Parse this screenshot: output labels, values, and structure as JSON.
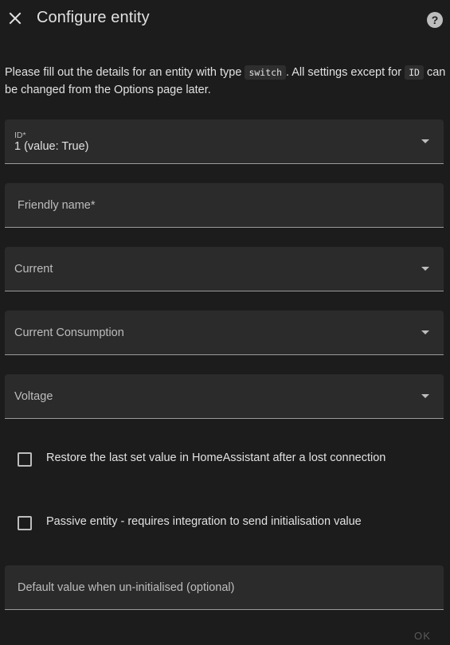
{
  "header": {
    "title": "Configure entity",
    "close_icon": "close-icon",
    "help_icon": "help-circle-icon"
  },
  "description": {
    "part1": "Please fill out the details for an entity with type ",
    "type_code": "switch",
    "part2": ". All settings except for ",
    "id_code": "ID",
    "part3": " can be changed from the Options page later."
  },
  "fields": {
    "id": {
      "label": "ID*",
      "value": "1 (value: True)"
    },
    "friendly_name": {
      "label": "Friendly name*",
      "value": ""
    },
    "current": {
      "label": "Current",
      "value": ""
    },
    "current_consumption": {
      "label": "Current Consumption",
      "value": ""
    },
    "voltage": {
      "label": "Voltage",
      "value": ""
    },
    "default_value": {
      "label": "Default value when un-initialised (optional)",
      "value": ""
    }
  },
  "checkboxes": {
    "restore": {
      "label": "Restore the last set value in HomeAssistant after a lost connection",
      "checked": false
    },
    "passive": {
      "label": "Passive entity - requires integration to send initialisation value",
      "checked": false
    }
  },
  "actions": {
    "ok_label": "OK"
  },
  "colors": {
    "background": "#1c1c1c",
    "field_background": "#2b2b2b",
    "text_primary": "#e1e1e1",
    "text_secondary": "#bdbdbd",
    "disabled": "#5a5a5a"
  }
}
